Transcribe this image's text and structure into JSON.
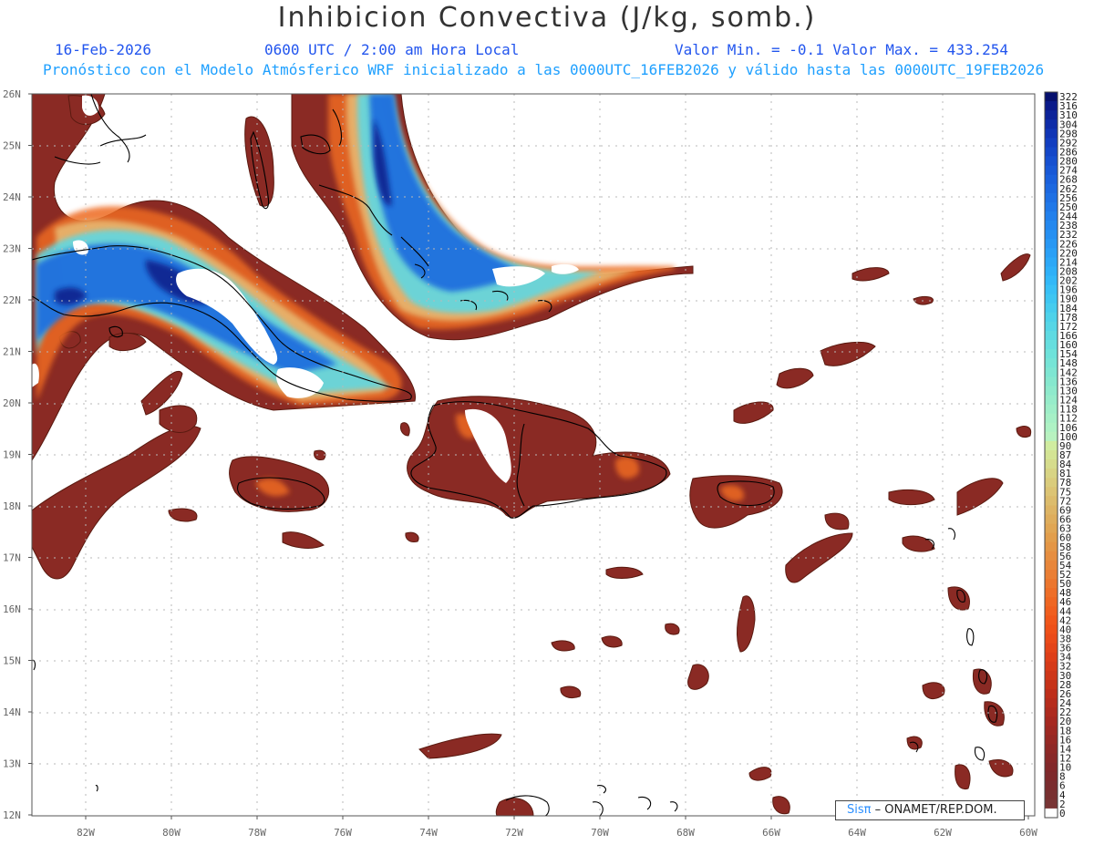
{
  "header": {
    "title": "Inhibicion Convectiva (J/kg, somb.)",
    "date": "16-Feb-2026",
    "time": "0600 UTC / 2:00 am Hora Local",
    "minmax": "Valor Min. = -0.1  Valor Max. = 433.254",
    "description": "Pronóstico con el Modelo Atmósferico WRF inicializado a las 0000UTC_16FEB2026 y válido hasta las  0000UTC_19FEB2026"
  },
  "map": {
    "lon_range": [
      -83.2,
      -59.8
    ],
    "lat_range": [
      11.9,
      26.1
    ],
    "lat_ticks": [
      "26N",
      "25N",
      "24N",
      "23N",
      "22N",
      "21N",
      "20N",
      "19N",
      "18N",
      "17N",
      "16N",
      "15N",
      "14N",
      "13N",
      "12N"
    ],
    "lon_ticks": [
      "82W",
      "80W",
      "78W",
      "76W",
      "74W",
      "72W",
      "70W",
      "68W",
      "66W",
      "64W",
      "62W",
      "60W"
    ]
  },
  "colorbar": {
    "labels": [
      "322",
      "316",
      "310",
      "304",
      "298",
      "292",
      "286",
      "280",
      "274",
      "268",
      "262",
      "256",
      "250",
      "244",
      "238",
      "232",
      "226",
      "220",
      "214",
      "208",
      "202",
      "196",
      "190",
      "184",
      "178",
      "172",
      "166",
      "160",
      "154",
      "148",
      "142",
      "136",
      "130",
      "124",
      "118",
      "112",
      "106",
      "100",
      "90",
      "87",
      "84",
      "81",
      "78",
      "75",
      "72",
      "69",
      "66",
      "63",
      "60",
      "58",
      "56",
      "54",
      "52",
      "50",
      "48",
      "46",
      "44",
      "42",
      "40",
      "38",
      "36",
      "34",
      "32",
      "30",
      "28",
      "26",
      "24",
      "22",
      "20",
      "18",
      "16",
      "14",
      "12",
      "10",
      "8",
      "6",
      "4",
      "2",
      "0"
    ],
    "colors": [
      "#06106e",
      "#0a1a8a",
      "#0c2399",
      "#0e2ca8",
      "#1035b5",
      "#123ec0",
      "#1447c8",
      "#1650d0",
      "#1858d6",
      "#1a60dc",
      "#1c68e0",
      "#1e70e4",
      "#2078e8",
      "#2280ec",
      "#2488ef",
      "#2690f2",
      "#2898f4",
      "#2aa0f6",
      "#2ca8f7",
      "#2eb0f8",
      "#32b8f8",
      "#38c0f6",
      "#3ec6f2",
      "#46ccee",
      "#4ed2ea",
      "#56d6e6",
      "#5edae2",
      "#66dede",
      "#6ee2da",
      "#76e4d6",
      "#7ee6d2",
      "#86e8ce",
      "#8eeacc",
      "#96ecca",
      "#9eeec8",
      "#a6f0c6",
      "#aef2c4",
      "#b8f2c0",
      "#d0eca0",
      "#d4e494",
      "#d6dc8c",
      "#d8d484",
      "#dacc7c",
      "#dcc474",
      "#dcbc6c",
      "#ddb464",
      "#dead5c",
      "#e0a654",
      "#e29e4c",
      "#e49646",
      "#e68e40",
      "#e8863a",
      "#ea7e34",
      "#ec762e",
      "#ee6e28",
      "#ef6622",
      "#f05e1e",
      "#f0561a",
      "#ee5018",
      "#ea4a18",
      "#e44418",
      "#de3e18",
      "#d63a18",
      "#ce3618",
      "#c63218",
      "#be2e1a",
      "#b62c1c",
      "#ae2a1e",
      "#a62820",
      "#9e2822",
      "#962824",
      "#8e2826",
      "#882828",
      "#82282a",
      "#7e2a2c",
      "#7a2c2e",
      "#783030",
      "#783434",
      "#ffffff"
    ]
  },
  "credit": {
    "logo": "Sisπ",
    "org": " – ONAMET/REP.DOM."
  }
}
